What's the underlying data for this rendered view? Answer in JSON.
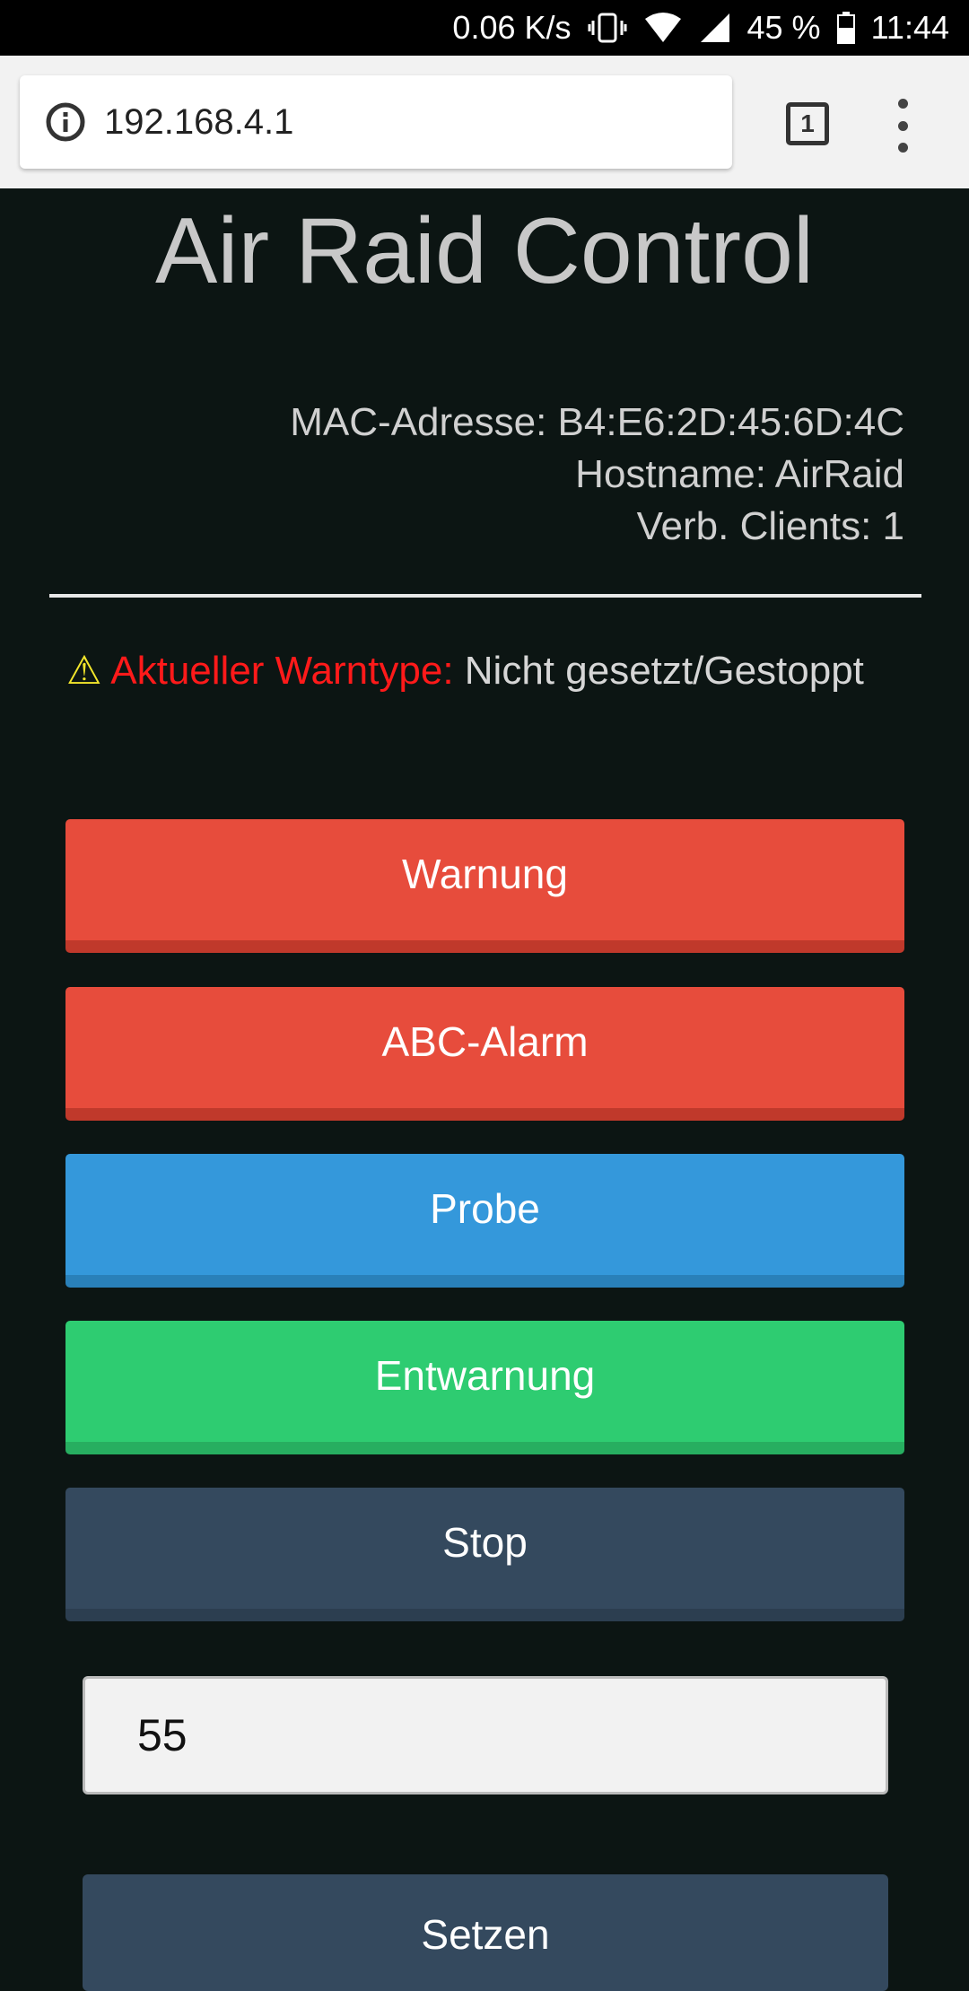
{
  "statusbar": {
    "speed": "0.06 K/s",
    "battery": "45 %",
    "time": "11:44"
  },
  "browser": {
    "url": "192.168.4.1",
    "tab_count": "1"
  },
  "page": {
    "title": "Air Raid Control",
    "info": {
      "mac": "MAC-Adresse: B4:E6:2D:45:6D:4C",
      "hostname": "Hostname: AirRaid",
      "clients": "Verb. Clients: 1"
    },
    "warning": {
      "icon": "⚠",
      "label": "Aktueller Warntype:",
      "value": "Nicht gesetzt/Gestoppt"
    },
    "buttons": {
      "warnung": "Warnung",
      "abc": "ABC-Alarm",
      "probe": "Probe",
      "entwarnung": "Entwarnung",
      "stop": "Stop",
      "setzen": "Setzen"
    },
    "input": {
      "value": "55"
    }
  },
  "colors": {
    "background": "#0c1513",
    "red": "#e74c3c",
    "blue": "#3498db",
    "green": "#2ecc71",
    "dark": "#34495e",
    "warning_label": "#ff1a1a"
  }
}
